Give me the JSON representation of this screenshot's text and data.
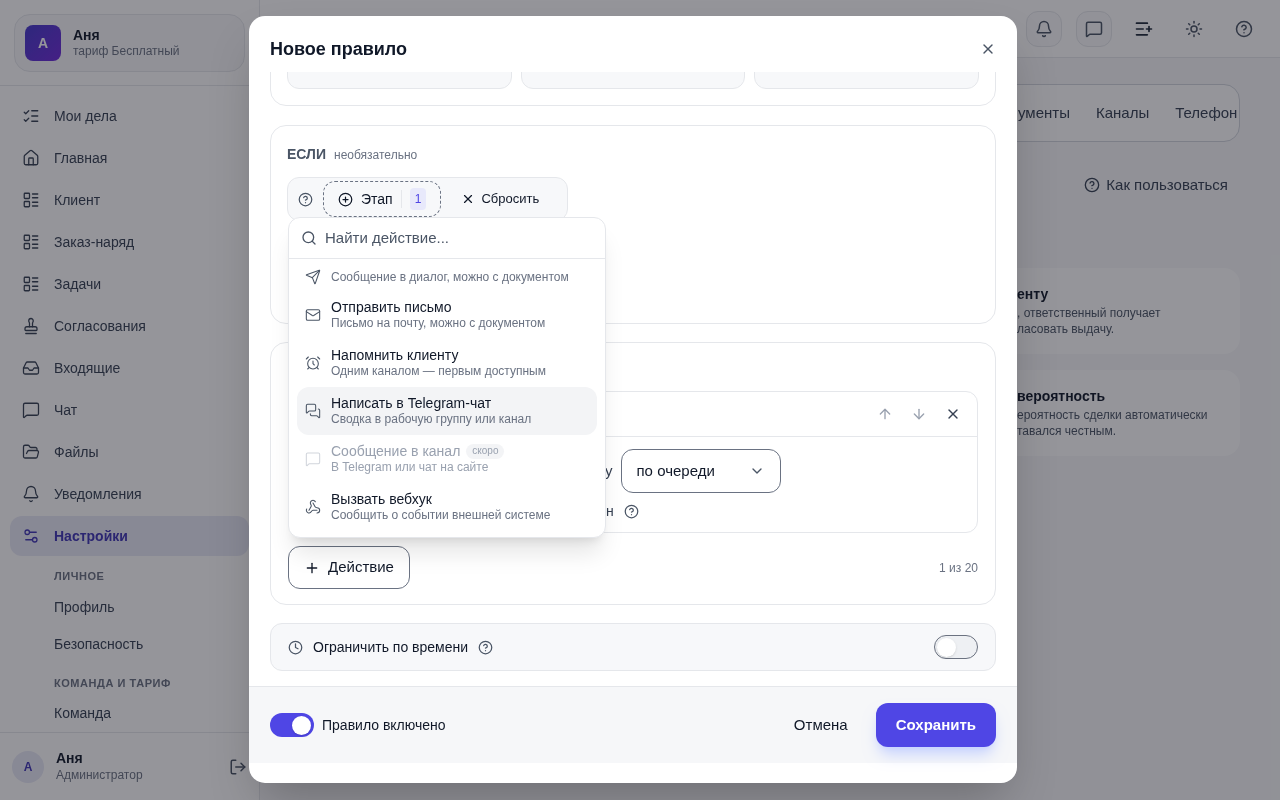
{
  "sidebar": {
    "account": {
      "avatar": "А",
      "name": "Аня",
      "plan": "тариф Бесплатный"
    },
    "items": [
      {
        "label": "Мои дела",
        "selected": false
      },
      {
        "label": "Главная",
        "selected": false
      },
      {
        "label": "Клиент",
        "selected": false
      },
      {
        "label": "Заказ-наряд",
        "selected": false
      },
      {
        "label": "Задачи",
        "selected": false
      },
      {
        "label": "Согласования",
        "selected": false
      },
      {
        "label": "Входящие",
        "selected": false
      },
      {
        "label": "Чат",
        "selected": false
      },
      {
        "label": "Файлы",
        "selected": false
      },
      {
        "label": "Уведомления",
        "selected": false
      },
      {
        "label": "Настройки",
        "selected": true
      }
    ],
    "subsections": [
      {
        "heading": "ЛИЧНОЕ",
        "items": [
          "Профиль",
          "Безопасность"
        ]
      },
      {
        "heading": "КОМАНДА И ТАРИФ",
        "items": [
          "Команда"
        ]
      }
    ],
    "user": {
      "avatar": "А",
      "name": "Аня",
      "role": "Администратор"
    }
  },
  "background": {
    "tabs": [
      "ументы",
      "Каналы",
      "Телефон"
    ],
    "help_link": "Как пользоваться",
    "cards": [
      {
        "title": "енту",
        "lines": [
          ", ответственный получает",
          "ласовать выдачу."
        ]
      },
      {
        "title": "вероятность",
        "lines": [
          "ероятность сделки автоматически",
          "тавался честным."
        ]
      }
    ]
  },
  "modal": {
    "title": "Новое правило",
    "if_section": {
      "label": "ЕСЛИ",
      "hint": "необязательно",
      "stage_chip": {
        "label": "Этап",
        "count": "1"
      },
      "reset": "Сбросить"
    },
    "action_menu": {
      "placeholder": "Найти действие...",
      "items": [
        {
          "subtitle": "Сообщение в диалог, можно с документом",
          "selected": false,
          "disabled": false
        },
        {
          "title": "Отправить письмо",
          "subtitle": "Письмо на почту, можно с документом",
          "selected": false,
          "disabled": false
        },
        {
          "title": "Напомнить клиенту",
          "subtitle": "Одним каналом — первым доступным",
          "selected": false,
          "disabled": false
        },
        {
          "title": "Написать в Telegram-чат",
          "subtitle": "Сводка в рабочую группу или канал",
          "selected": true,
          "disabled": false
        },
        {
          "title": "Сообщение в канал",
          "subtitle": "В Telegram или чат на сайте",
          "selected": false,
          "disabled": true,
          "badge": "скоро"
        },
        {
          "title": "Вызвать вебхук",
          "subtitle": "Сообщить о событии внешней системе",
          "selected": false,
          "disabled": false
        }
      ]
    },
    "action_card": {
      "fragment_1": "у",
      "select_value": "по очереди",
      "fragment_2": "н",
      "add_button": "Действие",
      "counter": "1 из 20"
    },
    "time_limit": {
      "label": "Ограничить по времени",
      "on": false
    },
    "footer": {
      "rule_enabled": {
        "label": "Правило включено",
        "on": true
      },
      "cancel": "Отмена",
      "save": "Сохранить"
    }
  }
}
